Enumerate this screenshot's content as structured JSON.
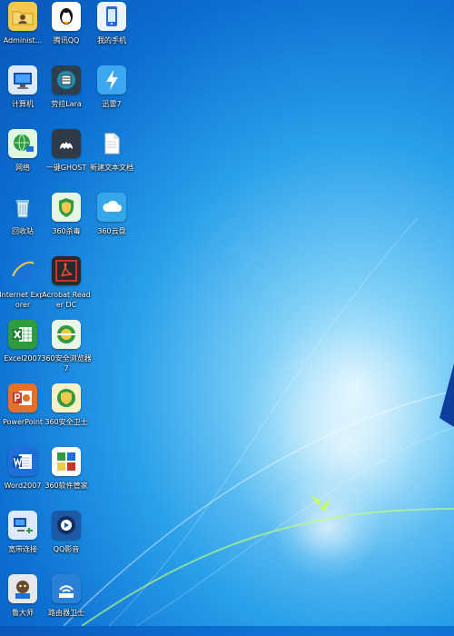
{
  "desktop": {
    "icons": [
      {
        "label": "Administ...",
        "icon": "user-folder-icon"
      },
      {
        "label": "腾讯QQ",
        "icon": "qq-penguin-icon"
      },
      {
        "label": "我的手机",
        "icon": "phone-app-icon"
      },
      {
        "label": "计算机",
        "icon": "computer-icon"
      },
      {
        "label": "劳拉Lara",
        "icon": "lara-app-icon"
      },
      {
        "label": "迅雷7",
        "icon": "thunder-app-icon"
      },
      {
        "label": "网络",
        "icon": "network-globe-icon"
      },
      {
        "label": "一键GHOST",
        "icon": "ghost-app-icon"
      },
      {
        "label": "新建文本文档",
        "icon": "text-document-icon"
      },
      {
        "label": "回收站",
        "icon": "recycle-bin-icon"
      },
      {
        "label": "360杀毒",
        "icon": "360-antivirus-icon"
      },
      {
        "label": "360云盘",
        "icon": "360-cloud-icon"
      },
      {
        "label": "Internet Explorer",
        "icon": "ie-icon"
      },
      {
        "label": "Acrobat Reader DC",
        "icon": "acrobat-icon"
      },
      {
        "label": "Excel2007",
        "icon": "excel-icon"
      },
      {
        "label": "360安全浏览器7",
        "icon": "360-browser-icon"
      },
      {
        "label": "PowerPoint",
        "icon": "powerpoint-icon"
      },
      {
        "label": "360安全卫士",
        "icon": "360-security-icon"
      },
      {
        "label": "Word2007",
        "icon": "word-icon"
      },
      {
        "label": "360软件管家",
        "icon": "360-software-icon"
      },
      {
        "label": "宽带连接",
        "icon": "broadband-icon"
      },
      {
        "label": "QQ影音",
        "icon": "qq-player-icon"
      },
      {
        "label": "鲁大师",
        "icon": "ludashi-icon"
      },
      {
        "label": "路由器卫士",
        "icon": "router-guard-icon"
      }
    ]
  },
  "colors": {
    "folder": "#f2c94c",
    "blue": "#1e6fd9",
    "green": "#2f9a3f",
    "red": "#c8342a",
    "orange": "#e5702a",
    "dark": "#2a2a2a",
    "cloud": "#35a7e8"
  }
}
